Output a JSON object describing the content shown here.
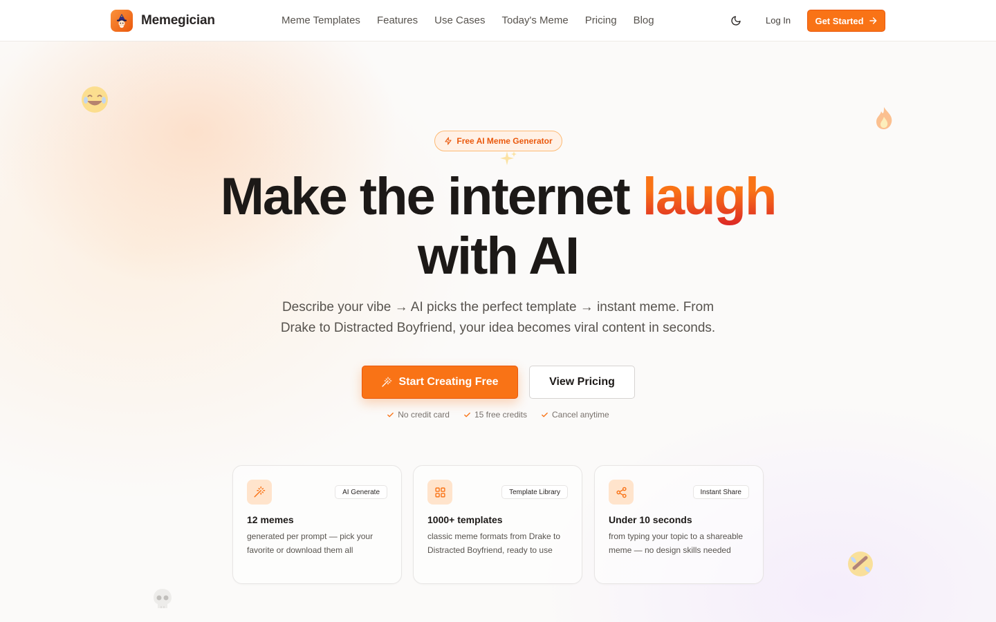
{
  "brand": {
    "name": "Memegician",
    "logo_icon": "wizard-icon"
  },
  "nav": {
    "items": [
      {
        "label": "Meme Templates"
      },
      {
        "label": "Features"
      },
      {
        "label": "Use Cases"
      },
      {
        "label": "Today's Meme"
      },
      {
        "label": "Pricing"
      },
      {
        "label": "Blog"
      }
    ],
    "theme_toggle_icon": "moon-icon",
    "login_label": "Log In",
    "cta_label": "Get Started"
  },
  "hero": {
    "badge": "Free AI Meme Generator",
    "headline_part1": "Make the internet ",
    "headline_accent": "laugh",
    "headline_part2": "with AI",
    "subtitle_line1": "Describe your vibe → AI picks the perfect template → instant meme. From",
    "subtitle_line2": "Drake to Distracted Boyfriend, your idea becomes viral content in seconds.",
    "primary_cta": "Start Creating Free",
    "secondary_cta": "View Pricing",
    "perks": [
      "No credit card",
      "15 free credits",
      "Cancel anytime"
    ]
  },
  "cards": [
    {
      "icon": "magic-wand-icon",
      "tag": "AI Generate",
      "title": "12 memes",
      "description": "generated per prompt — pick your favorite or download them all"
    },
    {
      "icon": "grid-icon",
      "tag": "Template Library",
      "title": "1000+ templates",
      "description": "classic meme formats from Drake to Distracted Boyfriend, ready to use"
    },
    {
      "icon": "share-icon",
      "tag": "Instant Share",
      "title": "Under 10 seconds",
      "description": "from typing your topic to a shareable meme — no design skills needed"
    }
  ],
  "decorations": [
    "laughing-emoji",
    "fire-emoji",
    "sparkles-emoji",
    "rofl-emoji",
    "skull-emoji"
  ],
  "colors": {
    "accent": "#f97316",
    "accent_dark": "#ea580c",
    "text": "#1c1917",
    "muted": "#57534e"
  }
}
